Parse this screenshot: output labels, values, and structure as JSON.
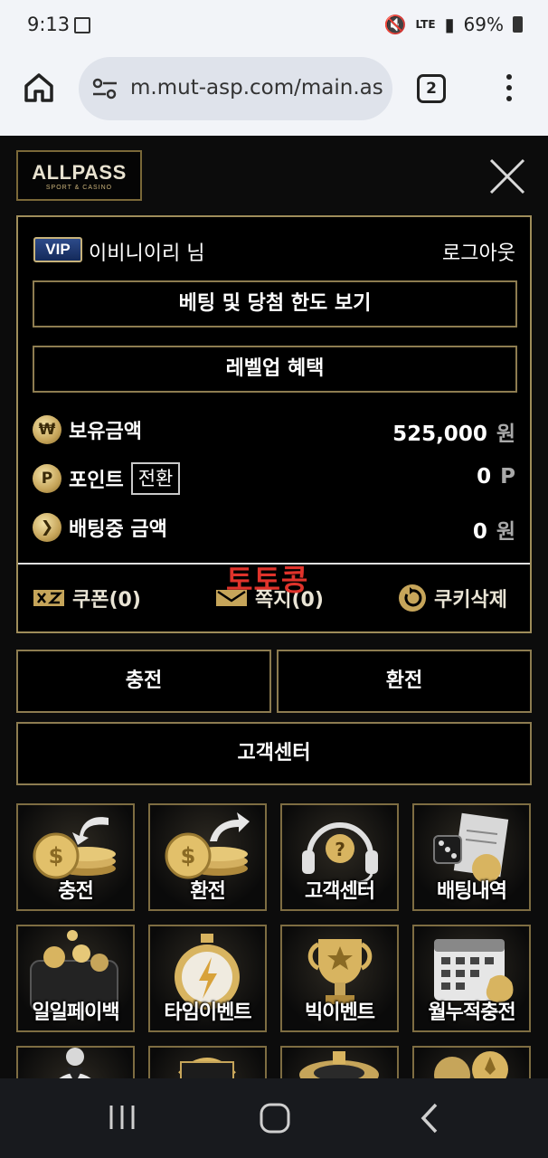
{
  "status": {
    "time": "9:13",
    "network": "LTE",
    "battery": "69%"
  },
  "browser": {
    "url": "m.mut-asp.com/main.as",
    "tab_count": "2"
  },
  "logo": {
    "title": "ALLPASS",
    "subtitle": "SPORT & CASINO"
  },
  "user": {
    "vip_badge": "VIP",
    "name": "이비니이리 님",
    "logout": "로그아웃",
    "limits_button": "베팅 및 당첨 한도 보기",
    "levelup_button": "레벨업 혜택",
    "balance_label": "보유금액",
    "balance_coin": "₩",
    "balance_value": "525,000",
    "balance_unit": "원",
    "points_label": "포인트",
    "points_coin": "P",
    "points_convert": "전환",
    "points_value": "0",
    "points_unit": "P",
    "betting_label": "배팅중 금액",
    "betting_coin": "❯",
    "betting_value": "0",
    "betting_unit": "원",
    "coupon": "쿠폰(0)",
    "message": "쪽지(0)",
    "cookie": "쿠키삭제"
  },
  "watermark": "토토콩",
  "actions": {
    "deposit": "충전",
    "withdraw": "환전",
    "support": "고객센터"
  },
  "tiles": [
    {
      "label": "충전"
    },
    {
      "label": "환전"
    },
    {
      "label": "고객센터"
    },
    {
      "label": "배팅내역"
    },
    {
      "label": "일일페이백"
    },
    {
      "label": "타임이벤트"
    },
    {
      "label": "빅이벤트"
    },
    {
      "label": "월누적충전"
    }
  ]
}
